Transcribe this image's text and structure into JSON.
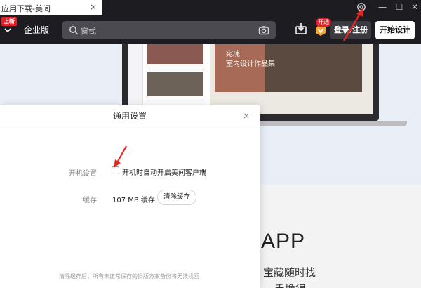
{
  "tab": {
    "title": "应用下载-美间",
    "close": "×"
  },
  "window_controls": {
    "minimize": "—",
    "maximize": "☐",
    "close": "✕"
  },
  "header": {
    "logo_badge": "上新",
    "enterprise": "企业版",
    "search_placeholder": "窗式",
    "vip_badge": "开通",
    "login_label": "登录/注册",
    "start_design_label": "开始设计"
  },
  "laptop_preview": {
    "cover_title_line1": "宛瑰",
    "cover_title_line2": "室内设计作品集"
  },
  "background": {
    "app_heading": "APP",
    "app_subtext": "宝藏随时找",
    "app_subtext2": "手撸得"
  },
  "dialog": {
    "title": "通用设置",
    "close": "×",
    "startup_label": "开机设置",
    "startup_option": "开机时自动开启美间客户端",
    "startup_checked": false,
    "cache_label": "缓存",
    "cache_value": "107 MB 缓存",
    "clear_cache_label": "清除缓存",
    "footnote": "清除缓存后，所有未正常保存的旧版方案备份将无法找回"
  },
  "colors": {
    "titlebar": "#1d1d21",
    "accent_red": "#e0212a",
    "annotation_arrow": "#e8261f"
  },
  "icons": [
    "settings-gear-icon",
    "chevron-down-icon",
    "search-icon",
    "camera-icon",
    "download-icon",
    "vip-icon",
    "close-icon"
  ]
}
